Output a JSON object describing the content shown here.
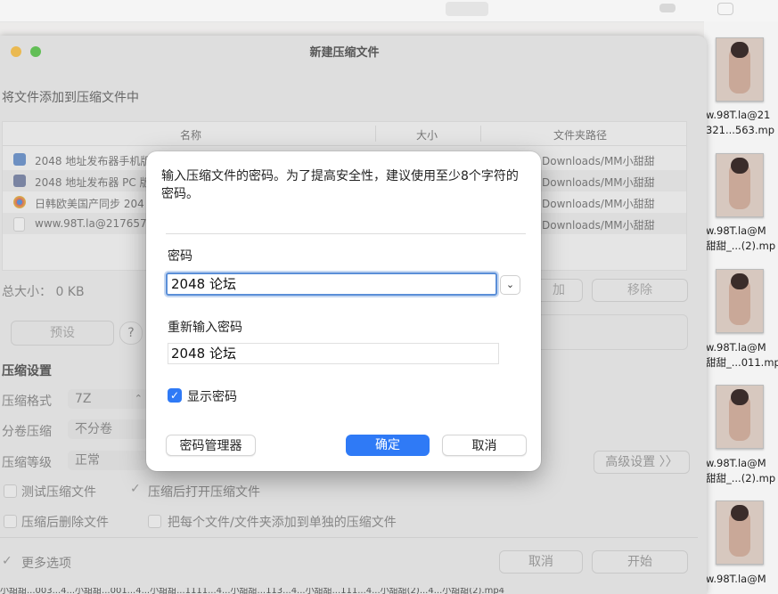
{
  "dialog": {
    "message": "输入压缩文件的密码。为了提高安全性，建议使用至少8个字符的密码。",
    "password_label": "密码",
    "password_value": "2048 论坛",
    "reenter_label": "重新输入密码",
    "reenter_value": "2048 论坛",
    "show_password_label": "显示密码",
    "show_password_checked": true,
    "manager_button": "密码管理器",
    "ok_button": "确定",
    "cancel_button": "取消"
  },
  "window": {
    "title": "新建压缩文件",
    "add_files_header": "将文件添加到压缩文件中",
    "columns": {
      "name": "名称",
      "size": "大小",
      "path": "文件夹路径"
    },
    "rows": [
      {
        "name": "2048 地址发布器手机版",
        "path": "Downloads/MM小甜甜",
        "icon": "apk-icon"
      },
      {
        "name": "2048 地址发布器 PC 版",
        "path": "Downloads/MM小甜甜",
        "icon": "rar-icon"
      },
      {
        "name": "日韩欧美国产同步 204",
        "path": "Downloads/MM小甜甜",
        "icon": "chrome-icon"
      },
      {
        "name": "www.98T.la@217657",
        "path": "Downloads/MM小甜甜",
        "icon": "file-icon"
      }
    ],
    "total_size_label": "总大小：",
    "total_size_value": "0 KB",
    "add_button_partial": "加",
    "remove_button": "移除",
    "preset_button": "预设",
    "help_button": "?",
    "compression_settings_header": "压缩设置",
    "format_label": "压缩格式",
    "format_value": "7Z",
    "split_label": "分卷压缩",
    "split_value": "不分卷",
    "level_label": "压缩等级",
    "level_value": "正常",
    "advanced_button": "高级设置 〉〉",
    "test_archive": "测试压缩文件",
    "open_after": "压缩后打开压缩文件",
    "delete_after": "压缩后删除文件",
    "separate_archives": "把每个文件/文件夹添加到单独的压缩文件",
    "more_options": "更多选项",
    "cancel_button": "取消",
    "start_button": "开始"
  },
  "desktop_files": [
    {
      "line1": "w.98T.la@21",
      "line2": "321...563.mp"
    },
    {
      "line1": "w.98T.la@M",
      "line2": "甜甜_...(2).mp"
    },
    {
      "line1": "w.98T.la@M",
      "line2": "甜甜_...011.mp"
    },
    {
      "line1": "w.98T.la@M",
      "line2": "甜甜_...(2).mp"
    },
    {
      "line1": "w.98T.la@M",
      "line2": ""
    }
  ],
  "bottom_strip": "小甜甜...003...4...小甜甜...001...4...小甜甜...1111...4...小甜甜...113...4...小甜甜...111...4...小甜甜(2)...4...小甜甜(2).mp4",
  "colors": {
    "accent": "#2f7af6",
    "focus": "#5b8fd8",
    "traffic_yellow": "#f5bf4f",
    "traffic_green": "#61c554"
  }
}
